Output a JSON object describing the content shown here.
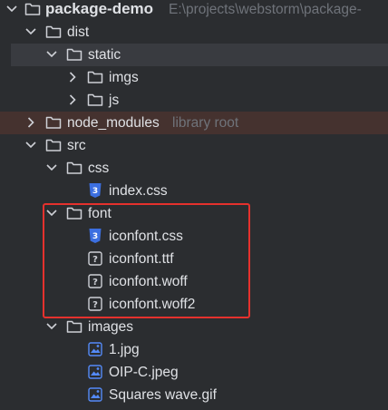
{
  "tree": {
    "root": {
      "label": "package-demo",
      "path_hint": "E:\\projects\\webstorm\\package-"
    },
    "dist": {
      "label": "dist"
    },
    "static": {
      "label": "static"
    },
    "imgs": {
      "label": "imgs"
    },
    "js": {
      "label": "js"
    },
    "node_modules": {
      "label": "node_modules",
      "hint": "library root"
    },
    "src": {
      "label": "src"
    },
    "css": {
      "label": "css"
    },
    "index_css": {
      "label": "index.css"
    },
    "font": {
      "label": "font"
    },
    "iconfont_css": {
      "label": "iconfont.css"
    },
    "iconfont_ttf": {
      "label": "iconfont.ttf"
    },
    "iconfont_woff": {
      "label": "iconfont.woff"
    },
    "iconfont_woff2": {
      "label": "iconfont.woff2"
    },
    "images": {
      "label": "images"
    },
    "img_1": {
      "label": "1.jpg"
    },
    "img_oip": {
      "label": "OIP-C.jpeg"
    },
    "img_squares": {
      "label": "Squares wave.gif"
    }
  },
  "icons": {
    "folder": "folder-icon",
    "css_file": "css-file-icon",
    "unknown_file": "unknown-file-icon",
    "image_file": "image-file-icon",
    "expanded": "chevron-down-icon",
    "collapsed": "chevron-right-icon"
  },
  "colors": {
    "background": "#2b2d30",
    "selected_row": "#393b40",
    "library_row": "#45322f",
    "text": "#dfe1e5",
    "hint": "#6f737a",
    "css_icon": "#3c6fe0",
    "image_icon": "#548af7",
    "highlight": "#e5312d"
  }
}
